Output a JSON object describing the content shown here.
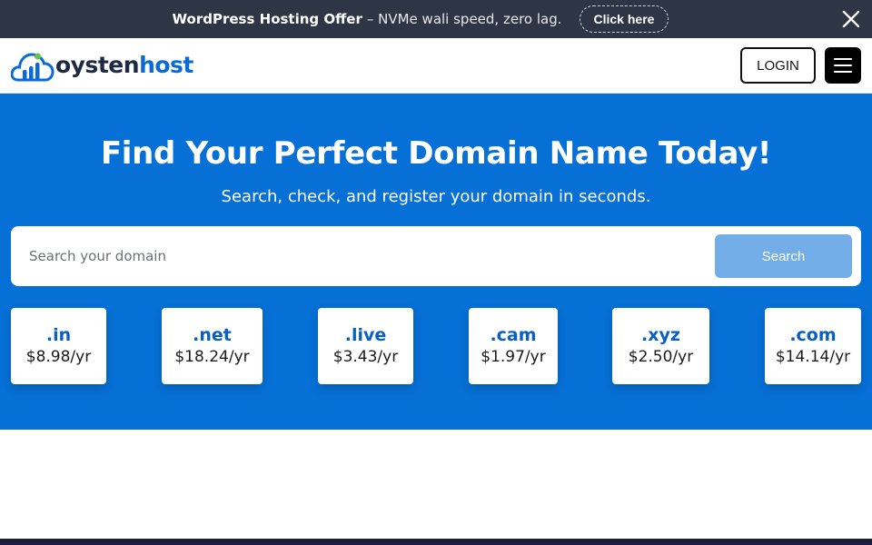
{
  "topbar": {
    "offer_title": "WordPress Hosting Offer",
    "offer_text": "– NVMe wali speed, zero lag.",
    "cta_label": "Click here",
    "close_icon": "close-icon"
  },
  "header": {
    "logo_part1": "oysten",
    "logo_part2": "host",
    "login_label": "LOGIN",
    "menu_icon": "hamburger-menu-icon"
  },
  "hero": {
    "title": "Find Your Perfect Domain Name Today!",
    "subtitle": "Search, check, and register your domain in seconds.",
    "search_placeholder": "Search your domain",
    "search_button": "Search"
  },
  "tlds": [
    {
      "name": ".in",
      "price": "$8.98/yr"
    },
    {
      "name": ".net",
      "price": "$18.24/yr"
    },
    {
      "name": ".live",
      "price": "$3.43/yr"
    },
    {
      "name": ".cam",
      "price": "$1.97/yr"
    },
    {
      "name": ".xyz",
      "price": "$2.50/yr"
    },
    {
      "name": ".com",
      "price": "$14.14/yr"
    }
  ],
  "colors": {
    "hero_bg": "#0670d6",
    "topbar_bg": "#2e3645",
    "search_button_bg": "#74aee8",
    "tld_text": "#0a5fc4",
    "logo_dark": "#1e2a44",
    "logo_blue": "#0a6bd6",
    "logo_green": "#6cc04a"
  }
}
